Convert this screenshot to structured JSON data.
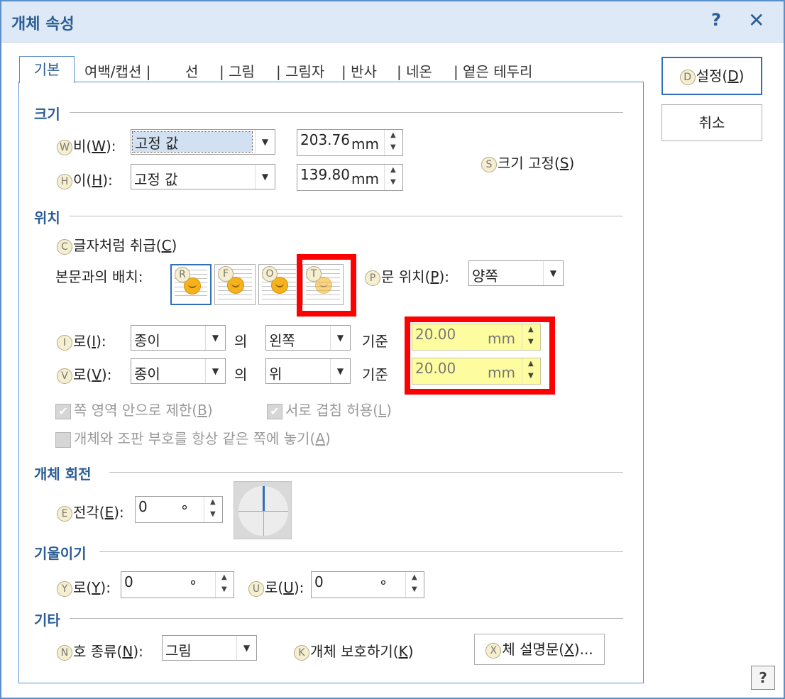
{
  "window": {
    "title": "개체 속성",
    "help_glyph": "?",
    "close_glyph": "✕"
  },
  "tabs": [
    "기본",
    "여백/캡션 |",
    "선",
    "| 그림",
    "| 그림자",
    "| 반사",
    "| 네온",
    "| 옅은 테두리"
  ],
  "sections": {
    "size": "크기",
    "position": "위치",
    "rotation": "개체 회전",
    "skew": "기울이기",
    "misc": "기타"
  },
  "size": {
    "width_label_pre": "비(",
    "width_key": "W",
    "width_label_post": "):",
    "width_mode": "고정 값",
    "width_value": "203.76",
    "height_label_pre": "이(",
    "height_key": "H",
    "height_label_post": "):",
    "height_mode": "고정 값",
    "height_value": "139.80",
    "unit": "mm",
    "lock_label_pre": "크기 고정(",
    "lock_key": "S",
    "lock_label_post": ")"
  },
  "position": {
    "treat_as_char_pre": "글자처럼 취급(",
    "treat_as_char_key": "C",
    "treat_as_char_post": ")",
    "wrap_label": "본문과의 배치:",
    "wrap_hotkeys": [
      "R",
      "F",
      "O",
      "T"
    ],
    "text_pos_label_pre": "문 위치(",
    "text_pos_key": "P",
    "text_pos_label_post": "):",
    "text_pos_value": "양쪽",
    "horiz_label_pre": "로(",
    "horiz_key": "I",
    "horiz_label_post": "):",
    "horiz_ref": "종이",
    "of": "의",
    "horiz_side": "왼쪽",
    "basis": "기준",
    "horiz_value": "20.00",
    "vert_label_pre": "로(",
    "vert_key": "V",
    "vert_label_post": "):",
    "vert_ref": "종이",
    "vert_side": "위",
    "vert_value": "20.00",
    "unit": "mm",
    "limit_label_pre": "쪽 영역 안으로 제한(",
    "limit_key": "B",
    "limit_label_post": ")",
    "overlap_label_pre": "서로 겹침 허용(",
    "overlap_key": "L",
    "overlap_label_post": ")",
    "same_page_label_pre": "개체와 조판 부호를 항상 같은 쪽에 놓기(",
    "same_page_key": "A",
    "same_page_label_post": ")"
  },
  "rotation": {
    "label_pre": "전각(",
    "key": "E",
    "label_post": "):",
    "value": "0",
    "unit": "°"
  },
  "skew": {
    "horiz_label_pre": "로(",
    "horiz_key": "Y",
    "horiz_label_post": "):",
    "horiz_value": "0",
    "vert_label_pre": "로(",
    "vert_key": "U",
    "vert_label_post": "):",
    "vert_value": "0",
    "unit": "°"
  },
  "misc": {
    "number_type_label_pre": "호 종류(",
    "number_type_key": "N",
    "number_type_label_post": "):",
    "number_type_value": "그림",
    "protect_label_pre": "개체 보호하기(",
    "protect_key": "K",
    "protect_label_post": ")",
    "desc_button_pre": "체 설명문(",
    "desc_key": "X",
    "desc_button_post": ")..."
  },
  "buttons": {
    "ok_pre": "설정(",
    "ok_key": "D",
    "ok_post": ")",
    "cancel": "취소",
    "help": "?"
  },
  "colors": {
    "accent": "#2b5d96",
    "highlight": "#fdfc9f",
    "annotation": "#ff0000"
  }
}
